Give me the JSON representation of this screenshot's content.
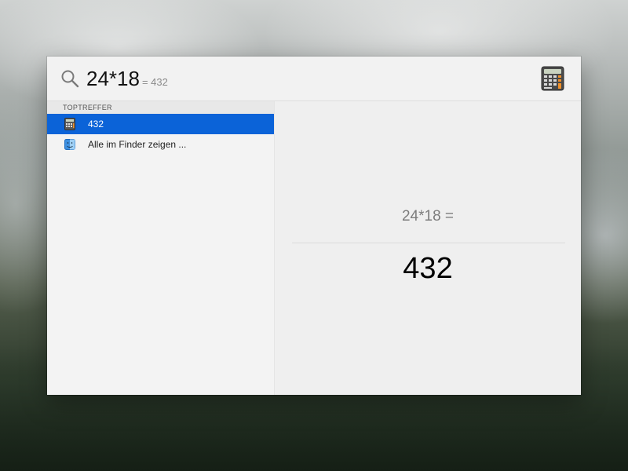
{
  "search": {
    "query": "24*18",
    "inline_result": "= 432"
  },
  "results": {
    "section_title": "TOPTREFFER",
    "items": [
      {
        "label": "432",
        "icon": "calculator-icon",
        "selected": true
      },
      {
        "label": "Alle im Finder zeigen ...",
        "icon": "finder-icon",
        "selected": false
      }
    ]
  },
  "preview": {
    "expression": "24*18 =",
    "result": "432"
  },
  "colors": {
    "selection": "#0b63d8",
    "panel_bg": "#efefef"
  }
}
